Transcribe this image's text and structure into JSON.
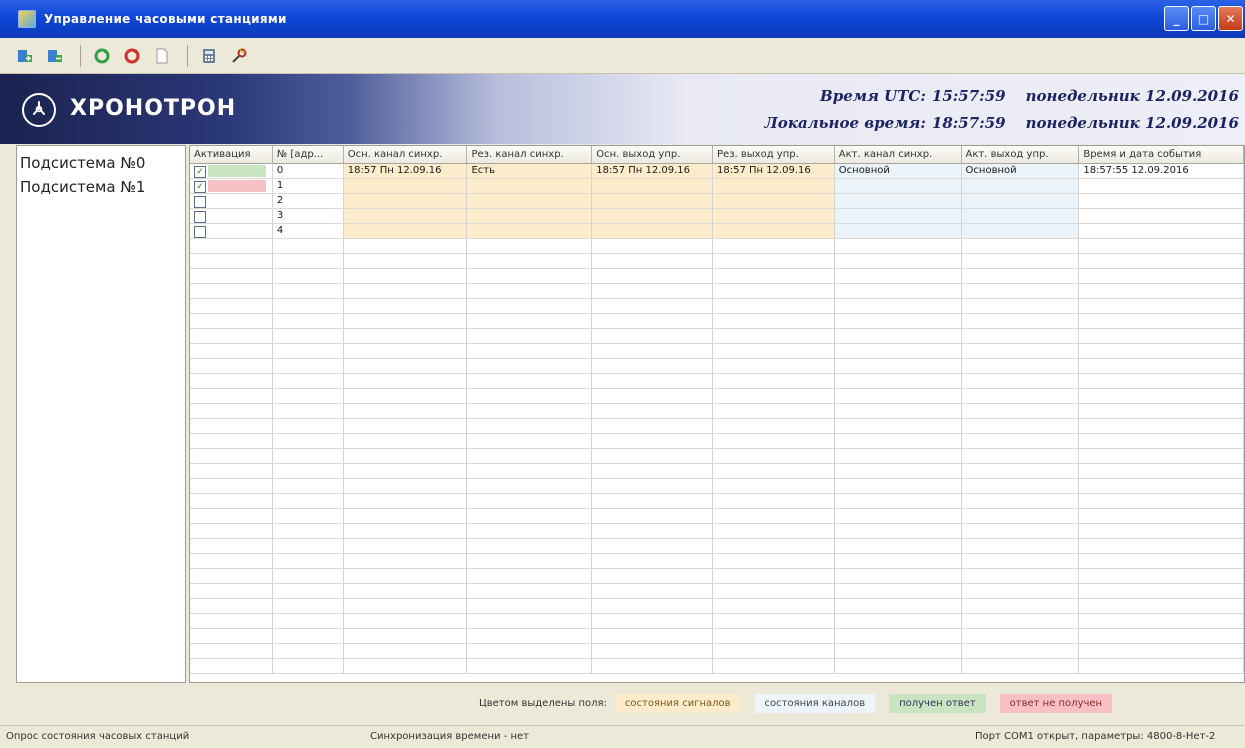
{
  "window": {
    "title": "Управление часовыми станциями",
    "buttons": [
      "_",
      "□",
      "✕"
    ]
  },
  "toolbar": {
    "icons": [
      "add-station-icon",
      "remove-station-icon",
      "refresh-green-icon",
      "refresh-red-icon",
      "document-icon",
      "calculator-icon",
      "settings-icon"
    ]
  },
  "banner": {
    "logo": "ХРОНОТРОН",
    "utc_label": "Время UTC:",
    "utc_time": "15:57:59",
    "utc_day": "понедельник 12.09.2016",
    "local_label": "Локальное время:",
    "local_time": "18:57:59",
    "local_day": "понедельник 12.09.2016"
  },
  "sidebar": {
    "items": [
      {
        "label": "Подсистема №0"
      },
      {
        "label": "Подсистема №1"
      }
    ]
  },
  "grid": {
    "columns": [
      "Активация",
      "№ [адр...",
      "Осн. канал синхр.",
      "Рез. канал синхр.",
      "Осн. выход упр.",
      "Рез. выход упр.",
      "Акт. канал синхр.",
      "Акт. выход упр.",
      "Время и дата события"
    ],
    "rows": [
      {
        "active": true,
        "status": "ok",
        "num": "0",
        "main_sync": "18:57 Пн 12.09.16",
        "res_sync": "Есть",
        "main_out": "18:57 Пн 12.09.16",
        "res_out": "18:57 Пн 12.09.16",
        "act_sync": "Основной",
        "act_out": "Основной",
        "event_time": "18:57:55 12.09.2016"
      },
      {
        "active": true,
        "status": "fail",
        "num": "1",
        "main_sync": "",
        "res_sync": "",
        "main_out": "",
        "res_out": "",
        "act_sync": "",
        "act_out": "",
        "event_time": ""
      },
      {
        "active": false,
        "status": "",
        "num": "2",
        "main_sync": "",
        "res_sync": "",
        "main_out": "",
        "res_out": "",
        "act_sync": "",
        "act_out": "",
        "event_time": ""
      },
      {
        "active": false,
        "status": "",
        "num": "3",
        "main_sync": "",
        "res_sync": "",
        "main_out": "",
        "res_out": "",
        "act_sync": "",
        "act_out": "",
        "event_time": ""
      },
      {
        "active": false,
        "status": "",
        "num": "4",
        "main_sync": "",
        "res_sync": "",
        "main_out": "",
        "res_out": "",
        "act_sync": "",
        "act_out": "",
        "event_time": ""
      }
    ]
  },
  "legend": {
    "intro": "Цветом выделены поля:",
    "signals": "состояния сигналов",
    "channels": "состояния каналов",
    "ok": "получен ответ",
    "fail": "ответ не получен"
  },
  "colors": {
    "signals": "#fdeccb",
    "channels": "#eaf2fa",
    "ok": "#c9e4c1",
    "fail": "#f6c0c4"
  },
  "statusbar": {
    "left": "Опрос состояния часовых станций",
    "middle": "Синхронизация времени - нет",
    "right": "Порт COM1 открыт, параметры: 4800-8-Нет-2"
  }
}
